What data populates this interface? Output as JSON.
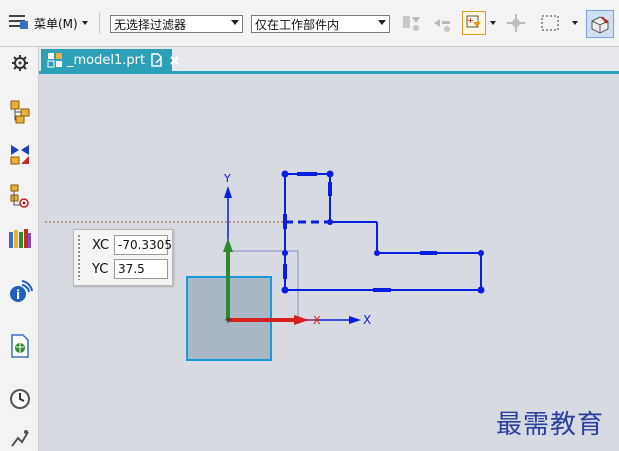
{
  "toolbar": {
    "menu_label": "菜单(M)",
    "filter_select": "无选择过滤器",
    "scope_select": "仅在工作部件内",
    "icons": [
      "menu-icon",
      "select-filter-icon",
      "snap-icon",
      "quick-pick-icon",
      "move-icon",
      "rectangle-select-icon",
      "view-orient-icon"
    ]
  },
  "left_toolbar": {
    "icons": [
      "settings-icon",
      "assembly-navigator-icon",
      "constraint-navigator-icon",
      "part-navigator-icon",
      "reuse-library-icon",
      "info-icon",
      "web-browser-icon",
      "history-icon",
      "roles-icon"
    ]
  },
  "tab": {
    "label": "_model1.prt",
    "icons": [
      "part-file-icon",
      "edit-icon",
      "close-icon"
    ]
  },
  "coord_input": {
    "xc_label": "XC",
    "xc_value": "-70.3305",
    "yc_label": "YC",
    "yc_value": "37.5"
  },
  "axes": {
    "x_label": "X",
    "y_label": "Y",
    "x_label_red": "X"
  },
  "colors": {
    "sketch": "#0a1ee0",
    "x_axis": "#d42020",
    "y_axis": "#2d8a2d",
    "tab": "#2e9fb8",
    "watermark": "#2a3fa0"
  },
  "watermark": "最需教育"
}
